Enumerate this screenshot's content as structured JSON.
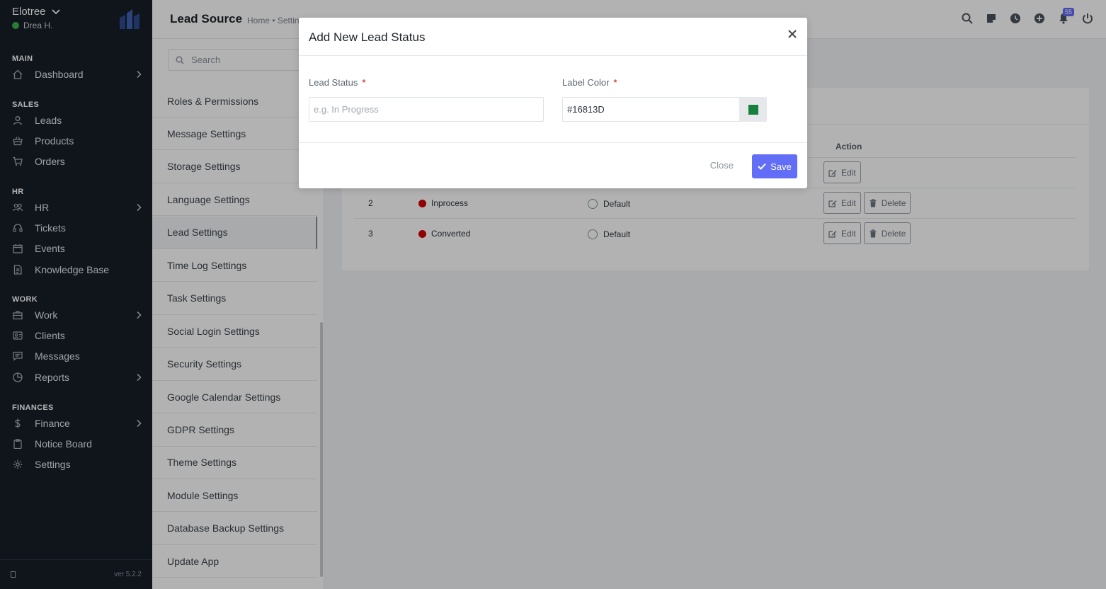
{
  "brand": {
    "name": "Elotree",
    "user": "Drea H."
  },
  "sidebar": {
    "sections": [
      {
        "label": "MAIN",
        "items": [
          {
            "label": "Dashboard",
            "icon": "home-icon",
            "chevron": true
          }
        ]
      },
      {
        "label": "SALES",
        "items": [
          {
            "label": "Leads",
            "icon": "user-icon",
            "chevron": false
          },
          {
            "label": "Products",
            "icon": "basket-icon",
            "chevron": false
          },
          {
            "label": "Orders",
            "icon": "cart-icon",
            "chevron": false
          }
        ]
      },
      {
        "label": "HR",
        "items": [
          {
            "label": "HR",
            "icon": "people-icon",
            "chevron": true
          },
          {
            "label": "Tickets",
            "icon": "headset-icon",
            "chevron": false
          },
          {
            "label": "Events",
            "icon": "calendar-icon",
            "chevron": false
          },
          {
            "label": "Knowledge Base",
            "icon": "document-icon",
            "chevron": false
          }
        ]
      },
      {
        "label": "WORK",
        "items": [
          {
            "label": "Work",
            "icon": "briefcase-icon",
            "chevron": true
          },
          {
            "label": "Clients",
            "icon": "client-icon",
            "chevron": false
          },
          {
            "label": "Messages",
            "icon": "message-icon",
            "chevron": false
          },
          {
            "label": "Reports",
            "icon": "pie-chart-icon",
            "chevron": true
          }
        ]
      },
      {
        "label": "FINANCES",
        "items": [
          {
            "label": "Finance",
            "icon": "dollar-icon",
            "chevron": true
          },
          {
            "label": "Notice Board",
            "icon": "clipboard-icon",
            "chevron": false
          },
          {
            "label": "Settings",
            "icon": "gear-icon",
            "chevron": false
          }
        ]
      }
    ],
    "version": "ver 5.2.2"
  },
  "header": {
    "title": "Lead Source",
    "breadcrumb": "Home • Settin",
    "notification_count": "55"
  },
  "settings_menu": {
    "search_placeholder": "Search",
    "items": [
      "Roles & Permissions",
      "Message Settings",
      "Storage Settings",
      "Language Settings",
      "Lead Settings",
      "Time Log Settings",
      "Task Settings",
      "Social Login Settings",
      "Security Settings",
      "Google Calendar Settings",
      "GDPR Settings",
      "Theme Settings",
      "Module Settings",
      "Database Backup Settings",
      "Update App"
    ],
    "active_index": 4
  },
  "table": {
    "action_header": "Action",
    "rows": [
      {
        "num": "",
        "status": "",
        "default": "",
        "delete": false
      },
      {
        "num": "2",
        "status": "Inprocess",
        "default": "Default",
        "delete": true
      },
      {
        "num": "3",
        "status": "Converted",
        "default": "Default",
        "delete": true
      }
    ],
    "edit_label": "Edit",
    "delete_label": "Delete",
    "status_color": "#d30000"
  },
  "modal": {
    "title": "Add New Lead Status",
    "lead_status_label": "Lead Status",
    "lead_status_placeholder": "e.g. In Progress",
    "label_color_label": "Label Color",
    "label_color_value": "#16813D",
    "close_label": "Close",
    "save_label": "Save",
    "save_color": "#616ef5"
  }
}
